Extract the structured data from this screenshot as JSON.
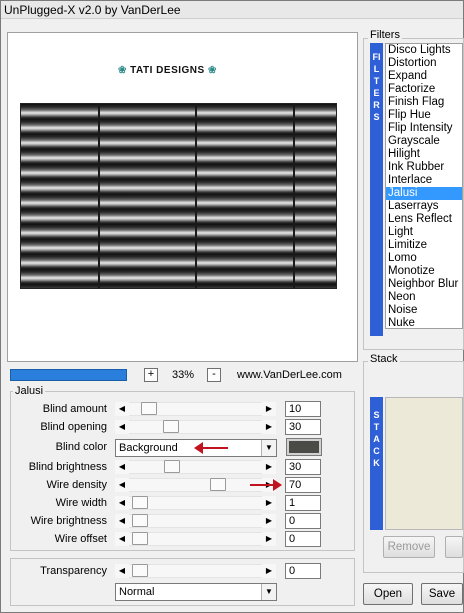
{
  "window": {
    "title": "UnPlugged-X v2.0 by VanDerLee"
  },
  "preview": {
    "logo_text": "TATI DESIGNS",
    "zoom_level": "33%",
    "zoom_in_label": "+",
    "zoom_out_label": "-",
    "website": "www.VanDerLee.com",
    "progress_fraction": 1.0
  },
  "jalusi": {
    "group_title": "Jalusi",
    "params": [
      {
        "label": "Blind amount",
        "value": "10"
      },
      {
        "label": "Blind opening",
        "value": "30"
      },
      {
        "label": "Blind brightness",
        "value": "30"
      },
      {
        "label": "Wire density",
        "value": "70"
      },
      {
        "label": "Wire width",
        "value": "1"
      },
      {
        "label": "Wire brightness",
        "value": "0"
      },
      {
        "label": "Wire offset",
        "value": "0"
      }
    ],
    "blind_color": {
      "label": "Blind color",
      "value": "Background",
      "swatch": "#4a4a46"
    },
    "transparency": {
      "label": "Transparency",
      "value": "0"
    },
    "blend_mode": "Normal"
  },
  "filters": {
    "title": "Filters",
    "side_letters": "FILTERS",
    "items": [
      "Disco Lights",
      "Distortion",
      "Expand",
      "Factorize",
      "Finish Flag",
      "Flip Hue",
      "Flip Intensity",
      "Grayscale",
      "Hilight",
      "Ink Rubber",
      "Interlace",
      "Jalusi",
      "Laserrays",
      "Lens Reflect",
      "Light",
      "Limitize",
      "Lomo",
      "Monotize",
      "Neighbor Blur",
      "Neon",
      "Noise",
      "Nuke"
    ],
    "selected": "Jalusi"
  },
  "stack": {
    "title": "Stack",
    "side_letters": "STACK",
    "remove_label": "Remove"
  },
  "footer": {
    "open_label": "Open",
    "save_label": "Save"
  },
  "colors": {
    "accent": "#3399ff",
    "side_bar": "#2f5fd6",
    "progress": "#2b7fdc"
  }
}
